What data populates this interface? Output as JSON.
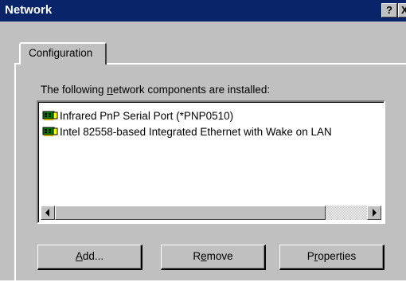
{
  "window": {
    "title": "Network",
    "help_glyph": "?",
    "close_glyph": "X"
  },
  "tabs": [
    {
      "label": "Configuration",
      "active": true
    }
  ],
  "components": {
    "description_pre": "The following ",
    "description_accel": "n",
    "description_post": "etwork components are installed:",
    "items": [
      {
        "label": "Infrared PnP Serial Port (*PNP0510)",
        "icon": "network-adapter-icon"
      },
      {
        "label": "Intel 82558-based Integrated Ethernet with Wake on LAN",
        "icon": "network-adapter-icon"
      }
    ]
  },
  "buttons": {
    "add": {
      "accel": "A",
      "rest": "dd..."
    },
    "remove": {
      "pre": "R",
      "accel": "e",
      "rest": "move"
    },
    "properties": {
      "pre": "P",
      "accel": "r",
      "rest": "operties"
    }
  },
  "colors": {
    "titlebar": "#0a246a",
    "face": "#c0c0c0"
  }
}
